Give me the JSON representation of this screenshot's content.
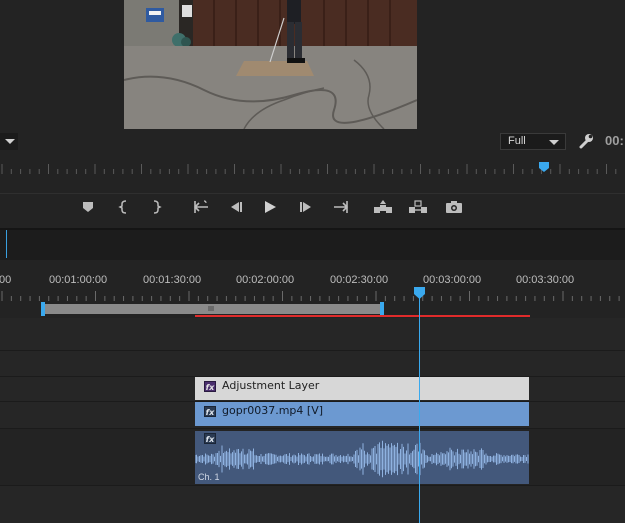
{
  "program_monitor": {
    "video_frame": "golfer-on-mat-in-driveway",
    "resolution": "Full",
    "timecode": "00:",
    "wrench_icon": "wrench-icon",
    "transport": [
      {
        "name": "add-marker-button",
        "icon": "marker-icon"
      },
      {
        "name": "mark-in-button",
        "icon": "mark-in-icon"
      },
      {
        "name": "mark-out-button",
        "icon": "mark-out-icon"
      },
      {
        "name": "go-to-in-button",
        "icon": "go-to-in-icon"
      },
      {
        "name": "step-back-button",
        "icon": "step-back-icon"
      },
      {
        "name": "play-button",
        "icon": "play-icon"
      },
      {
        "name": "step-forward-button",
        "icon": "step-forward-icon"
      },
      {
        "name": "go-to-out-button",
        "icon": "go-to-out-icon"
      },
      {
        "name": "lift-button",
        "icon": "lift-icon"
      },
      {
        "name": "extract-button",
        "icon": "extract-icon"
      },
      {
        "name": "export-frame-button",
        "icon": "camera-icon"
      }
    ]
  },
  "timeline": {
    "ruler_labels": [
      ":00",
      "00:01:00:00",
      "00:01:30:00",
      "00:02:00:00",
      "00:02:30:00",
      "00:03:00:00",
      "00:03:30:00"
    ],
    "clips": {
      "adjustment": {
        "label": "Adjustment Layer",
        "fx": "fx"
      },
      "video": {
        "label": "gopr0037.mp4 [V]",
        "fx": "fx"
      },
      "audio": {
        "fx": "fx",
        "channel": "Ch. 1"
      }
    },
    "colors": {
      "playhead": "#3aa9ee",
      "render_bar": "#e02b2b",
      "adjustment_clip": "#d7d7d7",
      "video_clip": "#6c99d1",
      "audio_clip": "#43587b",
      "waveform": "#8fb2e0"
    }
  }
}
